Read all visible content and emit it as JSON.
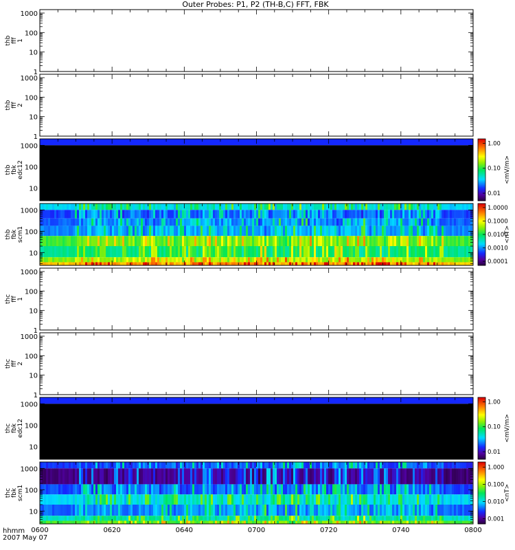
{
  "title": "Outer Probes: P1, P2 (TH-B,C) FFT, FBK",
  "time_axis": {
    "label_top": "hhmm",
    "label_bottom": "2007 May 07",
    "tick_labels": [
      "0600",
      "0620",
      "0640",
      "0700",
      "0720",
      "0740",
      "0800"
    ]
  },
  "chart_data": [
    {
      "type": "heatmap",
      "probe": "thb",
      "panel": "thb fff 1",
      "ylabel": [
        "thb",
        "fff",
        "1"
      ],
      "yscale": "log",
      "ylim": [
        1,
        1500
      ],
      "yticks": [
        "1000",
        "100",
        "10",
        "1"
      ],
      "has_data": false,
      "colorbar": null
    },
    {
      "type": "heatmap",
      "probe": "thb",
      "panel": "thb fff 2",
      "ylabel": [
        "thb",
        "fff",
        "2"
      ],
      "yscale": "log",
      "ylim": [
        1,
        1500
      ],
      "yticks": [
        "1000",
        "100",
        "10",
        "1"
      ],
      "has_data": false,
      "colorbar": null
    },
    {
      "type": "heatmap",
      "probe": "thb",
      "panel": "thb fbk edc12",
      "ylabel": [
        "thb",
        "fbk",
        "edc12"
      ],
      "yscale": "log",
      "ylim": [
        2.5,
        2000
      ],
      "yticks": [
        "1000",
        "100",
        "10"
      ],
      "has_data": true,
      "pattern": "flat",
      "bands": [
        {
          "f_low": 1000,
          "f_high": 2000,
          "level": 0.2
        },
        {
          "f_low": 2.5,
          "f_high": 1000,
          "level": 0
        }
      ],
      "colorbar": {
        "unit": "<mV/m>",
        "ticks": [
          "1.00",
          "0.10",
          "0.01"
        ],
        "range": [
          0.005,
          1.5
        ]
      }
    },
    {
      "type": "heatmap",
      "probe": "thb",
      "panel": "thb fbk scm1",
      "ylabel": [
        "thb",
        "fbk",
        "scm1"
      ],
      "yscale": "log",
      "ylim": [
        2.5,
        2000
      ],
      "yticks": [
        "1000",
        "100",
        "10"
      ],
      "has_data": true,
      "pattern": "active",
      "bands": [
        {
          "f_low": 1000,
          "f_high": 2000,
          "level": 0.35
        },
        {
          "f_low": 400,
          "f_high": 1000,
          "level": 0.22
        },
        {
          "f_low": 180,
          "f_high": 400,
          "level": 0.25
        },
        {
          "f_low": 60,
          "f_high": 180,
          "level": 0.28
        },
        {
          "f_low": 20,
          "f_high": 60,
          "level": 0.55
        },
        {
          "f_low": 6,
          "f_high": 20,
          "level": 0.45
        },
        {
          "f_low": 3.5,
          "f_high": 6,
          "level": 0.6
        },
        {
          "f_low": 2.5,
          "f_high": 3.5,
          "level": 0.78
        }
      ],
      "colorbar": {
        "unit": "<nT>",
        "ticks": [
          "1.0000",
          "0.1000",
          "0.0100",
          "0.0010",
          "0.0001"
        ],
        "range": [
          5e-05,
          2
        ]
      }
    },
    {
      "type": "heatmap",
      "probe": "thc",
      "panel": "thc fff 1",
      "ylabel": [
        "thc",
        "fff",
        "1"
      ],
      "yscale": "log",
      "ylim": [
        1,
        1500
      ],
      "yticks": [
        "1000",
        "100",
        "10",
        "1"
      ],
      "has_data": false,
      "colorbar": null
    },
    {
      "type": "heatmap",
      "probe": "thc",
      "panel": "thc fff 2",
      "ylabel": [
        "thc",
        "fff",
        "2"
      ],
      "yscale": "log",
      "ylim": [
        1,
        1500
      ],
      "yticks": [
        "1000",
        "100",
        "10",
        "1"
      ],
      "has_data": false,
      "colorbar": null
    },
    {
      "type": "heatmap",
      "probe": "thc",
      "panel": "thc fbk edc12",
      "ylabel": [
        "thc",
        "fbk",
        "edc12"
      ],
      "yscale": "log",
      "ylim": [
        2.5,
        2000
      ],
      "yticks": [
        "1000",
        "100",
        "10"
      ],
      "has_data": true,
      "pattern": "flat",
      "bands": [
        {
          "f_low": 1000,
          "f_high": 2000,
          "level": 0.2
        },
        {
          "f_low": 2.5,
          "f_high": 1000,
          "level": 0
        }
      ],
      "colorbar": {
        "unit": "<mV/m>",
        "ticks": [
          "1.00",
          "0.10",
          "0.01"
        ],
        "range": [
          0.005,
          1.5
        ]
      }
    },
    {
      "type": "heatmap",
      "probe": "thc",
      "panel": "thc fbk scm1",
      "ylabel": [
        "thc",
        "fbk",
        "scm1"
      ],
      "yscale": "log",
      "ylim": [
        2.5,
        2000
      ],
      "yticks": [
        "1000",
        "100",
        "10"
      ],
      "has_data": true,
      "pattern": "active",
      "bands": [
        {
          "f_low": 1000,
          "f_high": 2000,
          "level": 0.2
        },
        {
          "f_low": 180,
          "f_high": 1000,
          "level": 0.06
        },
        {
          "f_low": 60,
          "f_high": 180,
          "level": 0.22
        },
        {
          "f_low": 20,
          "f_high": 60,
          "level": 0.35
        },
        {
          "f_low": 6,
          "f_high": 20,
          "level": 0.25
        },
        {
          "f_low": 3.5,
          "f_high": 6,
          "level": 0.4
        },
        {
          "f_low": 2.5,
          "f_high": 3.5,
          "level": 0.55
        }
      ],
      "colorbar": {
        "unit": "<nT>",
        "ticks": [
          "1.000",
          "0.100",
          "0.010",
          "0.001"
        ],
        "range": [
          0.0005,
          2
        ]
      }
    }
  ]
}
